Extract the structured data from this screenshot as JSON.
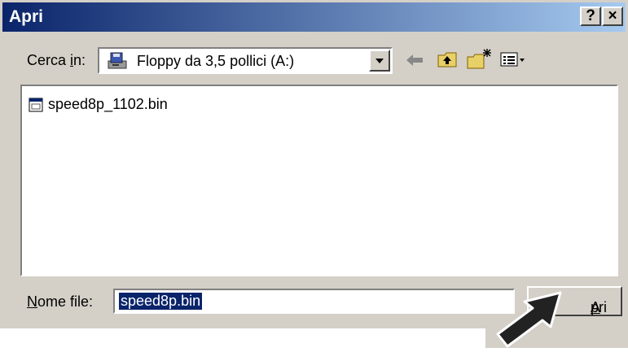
{
  "window": {
    "title": "Apri",
    "help_label": "?",
    "close_label": "×"
  },
  "lookin": {
    "label_pre": "Cerca ",
    "label_accel": "i",
    "label_post": "n:",
    "value": "Floppy da 3,5 pollici (A:)"
  },
  "toolbar": {
    "icons": [
      "back-arrow-icon",
      "up-folder-icon",
      "new-folder-icon",
      "view-menu-icon"
    ]
  },
  "files": [
    {
      "name": "speed8p_1102.bin",
      "icon": "binary-file-icon"
    }
  ],
  "filename": {
    "label_accel": "N",
    "label_rest": "ome file:",
    "value": "speed8p.bin"
  },
  "open_button": {
    "accel": "A",
    "rest": "pri"
  },
  "colors": {
    "title_start": "#0a246a",
    "title_end": "#a6caf0",
    "face": "#d4d0c8",
    "selection": "#0a246a"
  }
}
